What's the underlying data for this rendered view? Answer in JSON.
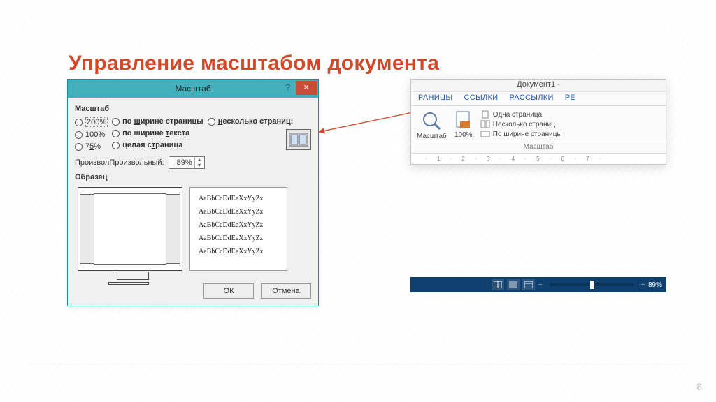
{
  "slide": {
    "title": "Управление масштабом документа",
    "page_number": "8"
  },
  "dialog": {
    "title": "Масштаб",
    "help": "?",
    "close": "×",
    "group_label": "Масштаб",
    "radios": {
      "p200": "200%",
      "p100": "100%",
      "p75_pre": "7",
      "p75_u": "5",
      "p75_post": "%",
      "width_pre": "по ",
      "width_u": "ш",
      "width_post": "ирине страницы",
      "textw_pre": "по ширине ",
      "textw_u": "т",
      "textw_post": "екста",
      "whole_pre": "целая с",
      "whole_u": "т",
      "whole_post": "раница",
      "multi_pre": "",
      "multi_u": "н",
      "multi_post": "есколько страниц:"
    },
    "custom_label_pre": "Произвол",
    "custom_label_u": "ь",
    "custom_label_post": "ный:",
    "custom_value": "89%",
    "sample_label": "Образец",
    "sample_line": "AaBbCcDdEeXxYyZz",
    "ok": "ОК",
    "cancel": "Отмена"
  },
  "ribbon": {
    "doc_title": "Документ1 -",
    "tabs": [
      "РАНИЦЫ",
      "ССЫЛКИ",
      "РАССЫЛКИ",
      "РЕ"
    ],
    "zoom_btn": "Масштаб",
    "p100": "100%",
    "one_page": "Одна страница",
    "multi_page": "Несколько страниц",
    "page_width": "По ширине страницы",
    "group_label": "Масштаб",
    "ruler": "· 1 · 2 · 3 · 4 · 5 · 6 · 7 ·"
  },
  "status": {
    "minus": "−",
    "plus": "+",
    "value": "89%"
  }
}
